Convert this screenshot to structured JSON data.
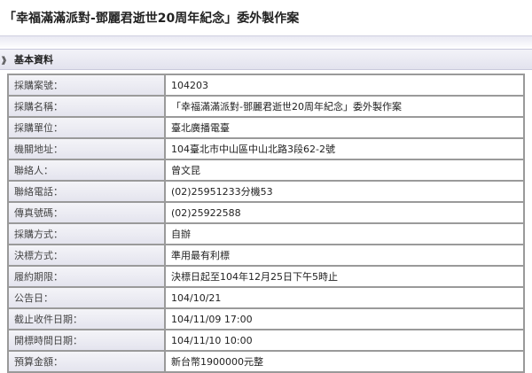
{
  "page": {
    "title": "「幸福滿滿派對-鄧麗君逝世20周年紀念」委外製作案"
  },
  "section": {
    "icon": "double-chevron-right-icon",
    "icon_glyph": "》",
    "title": "基本資料"
  },
  "rows": [
    {
      "label": "採購案號：",
      "value": "104203"
    },
    {
      "label": "採購名稱：",
      "value": "「幸福滿滿派對-鄧麗君逝世20周年紀念」委外製作案"
    },
    {
      "label": "採購單位：",
      "value": "臺北廣播電臺"
    },
    {
      "label": "機關地址：",
      "value": "104臺北市中山區中山北路3段62-2號"
    },
    {
      "label": "聯絡人：",
      "value": "曾文昆"
    },
    {
      "label": "聯絡電話：",
      "value": "(02)25951233分機53"
    },
    {
      "label": "傳真號碼：",
      "value": "(02)25922588"
    },
    {
      "label": "採購方式：",
      "value": "自辦"
    },
    {
      "label": "決標方式：",
      "value": "準用最有利標"
    },
    {
      "label": "履約期限：",
      "value": "決標日起至104年12月25日下午5時止"
    },
    {
      "label": "公告日：",
      "value": "104/10/21"
    },
    {
      "label": "截止收件日期：",
      "value": "104/11/09 17:00"
    },
    {
      "label": "開標時間日期：",
      "value": "104/11/10 10:00"
    },
    {
      "label": "預算金額：",
      "value": "新台幣1900000元整"
    }
  ]
}
